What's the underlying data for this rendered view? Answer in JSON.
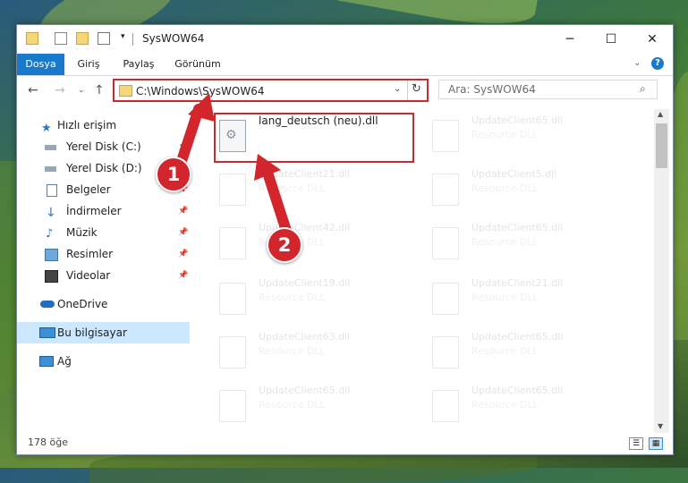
{
  "window": {
    "title": "SysWOW64"
  },
  "ribbon": {
    "tabs": [
      "Dosya",
      "Giriş",
      "Paylaş",
      "Görünüm"
    ]
  },
  "address": {
    "path": "C:\\Windows\\SysWOW64"
  },
  "search": {
    "placeholder": "Ara: SysWOW64"
  },
  "nav": {
    "items": [
      {
        "label": "Hızlı erişim",
        "icon": "star-icon"
      },
      {
        "label": "Yerel Disk (C:)",
        "icon": "drive-icon"
      },
      {
        "label": "Yerel Disk (D:)",
        "icon": "drive-icon"
      },
      {
        "label": "Belgeler",
        "icon": "documents-icon"
      },
      {
        "label": "İndirmeler",
        "icon": "download-icon"
      },
      {
        "label": "Müzik",
        "icon": "music-icon"
      },
      {
        "label": "Resimler",
        "icon": "pictures-icon"
      },
      {
        "label": "Videolar",
        "icon": "video-icon"
      },
      {
        "label": "OneDrive",
        "icon": "cloud-icon"
      },
      {
        "label": "Bu bilgisayar",
        "icon": "computer-icon"
      },
      {
        "label": "Ağ",
        "icon": "network-icon"
      }
    ]
  },
  "files": {
    "highlighted": {
      "name": "lang_deutsch (neu).dll"
    },
    "left": [
      {
        "name": "UpdateClient21.dll",
        "type": "Resource DLL"
      },
      {
        "name": "UpdateClient42.dll",
        "type": "Resource DLL"
      },
      {
        "name": "UpdateClient19.dll",
        "type": "Resource DLL"
      },
      {
        "name": "UpdateClient63.dll",
        "type": "Resource DLL"
      },
      {
        "name": "UpdateClient65.dll",
        "type": "Resource DLL"
      }
    ],
    "right": [
      {
        "name": "UpdateClient65.dll",
        "type": "Resource DLL"
      },
      {
        "name": "UpdateClient5.dll",
        "type": "Resource DLL"
      },
      {
        "name": "UpdateClient65.dll",
        "type": "Resource DLL"
      },
      {
        "name": "UpdateClient21.dll",
        "type": "Resource DLL"
      },
      {
        "name": "UpdateClient65.dll",
        "type": "Resource DLL"
      },
      {
        "name": "UpdateClient65.dll",
        "type": "Resource DLL"
      }
    ]
  },
  "status": {
    "count": "178 öğe"
  },
  "callouts": {
    "one": "1",
    "two": "2"
  },
  "colors": {
    "accent": "#1979ca",
    "highlight": "#d2262c",
    "selected": "#cce8ff"
  }
}
